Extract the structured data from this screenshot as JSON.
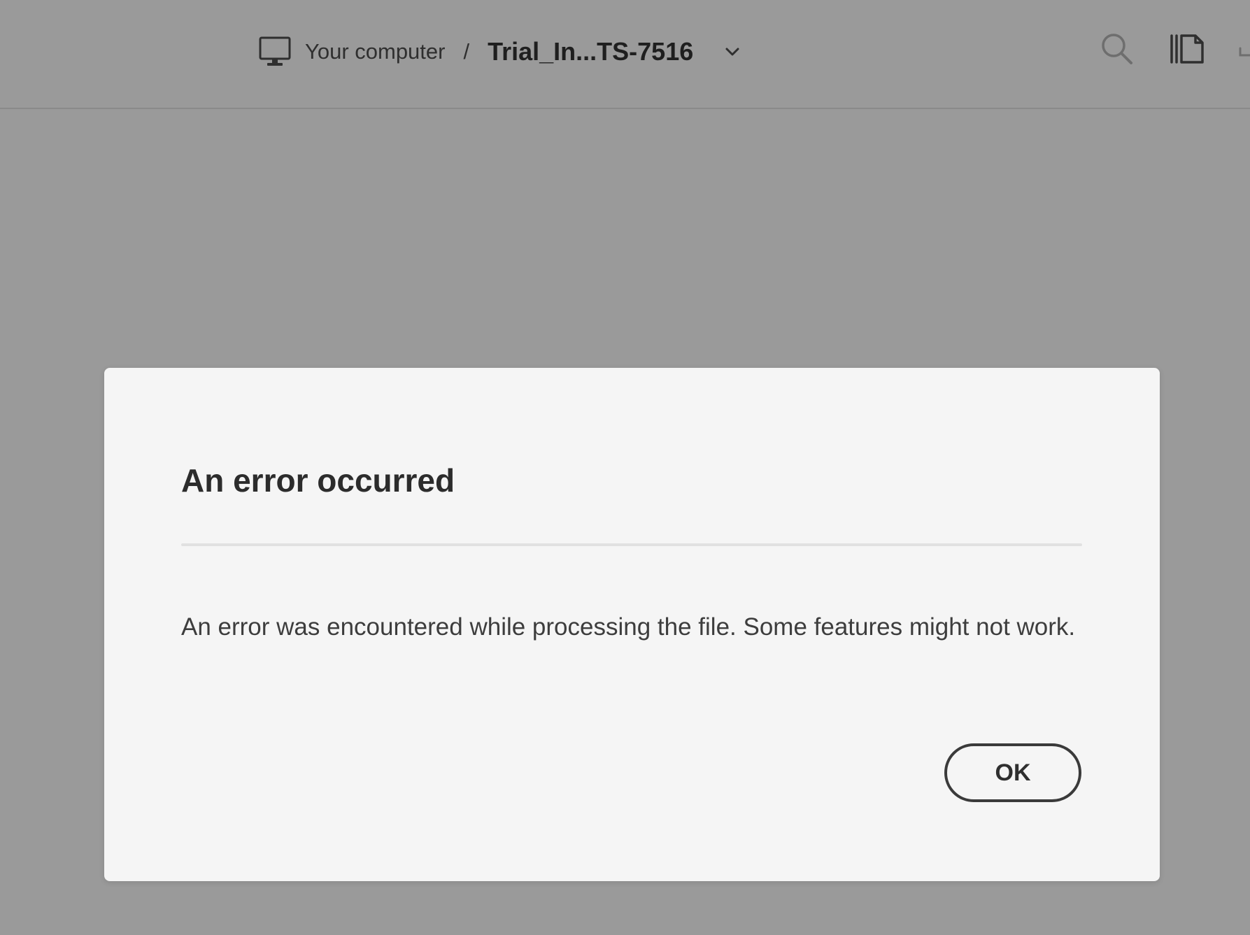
{
  "header": {
    "location_label": "Your computer",
    "separator": "/",
    "file_name": "Trial_In...TS-7516",
    "icons": {
      "location": "monitor-icon",
      "file_menu": "chevron-down-icon",
      "search": "search-icon",
      "pages": "pages-panel-icon"
    }
  },
  "dialog": {
    "title": "An error occurred",
    "message": "An error was encountered while processing the file. Some features might not work.",
    "ok_label": "OK"
  },
  "colors": {
    "overlay": "#9a9a9a",
    "dialog_bg": "#f5f5f5",
    "text_primary": "#2c2c2c",
    "button_border": "#3a3a3a"
  }
}
